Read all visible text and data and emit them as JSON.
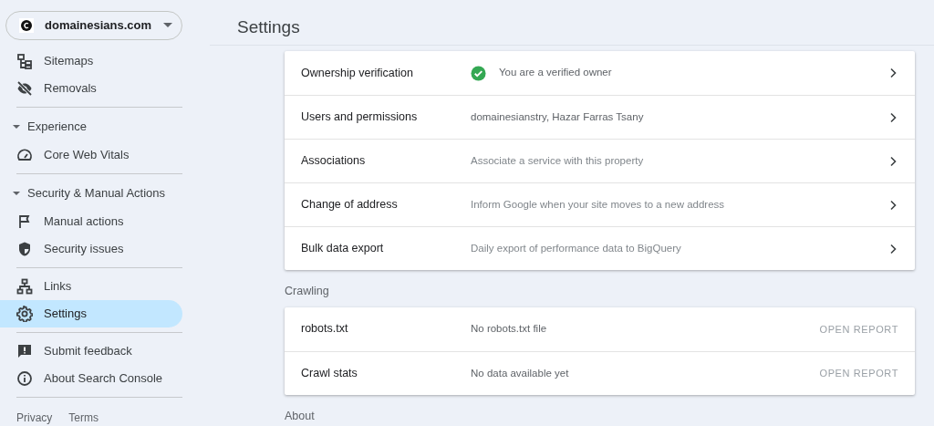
{
  "sidebar": {
    "property": "domainesians.com",
    "groups": [
      {
        "items": [
          {
            "label": "Sitemaps",
            "selected": false
          },
          {
            "label": "Removals",
            "selected": false
          }
        ]
      },
      {
        "heading": "Experience",
        "expanded": true,
        "items": [
          {
            "label": "Core Web Vitals",
            "selected": false
          }
        ]
      },
      {
        "heading": "Security & Manual Actions",
        "expanded": true,
        "items": [
          {
            "label": "Manual actions",
            "selected": false
          },
          {
            "label": "Security issues",
            "selected": false
          }
        ]
      },
      {
        "items": [
          {
            "label": "Links",
            "selected": false
          },
          {
            "label": "Settings",
            "selected": true
          }
        ]
      },
      {
        "items": [
          {
            "label": "Submit feedback",
            "selected": false
          },
          {
            "label": "About Search Console",
            "selected": false
          }
        ]
      }
    ],
    "footer_links": [
      "Privacy",
      "Terms"
    ]
  },
  "page_title": "Settings",
  "sections": [
    {
      "rows": [
        {
          "label": "Ownership verification",
          "value": "You are a verified owner",
          "kind": "value",
          "verified": true
        },
        {
          "label": "Users and permissions",
          "value": "domainesianstry, Hazar Farras Tsany",
          "kind": "value",
          "verified": false
        },
        {
          "label": "Associations",
          "value": "Associate a service with this property",
          "kind": "hint",
          "verified": false
        },
        {
          "label": "Change of address",
          "value": "Inform Google when your site moves to a new address",
          "kind": "hint",
          "verified": false
        },
        {
          "label": "Bulk data export",
          "value": "Daily export of performance data to BigQuery",
          "kind": "hint",
          "verified": false
        }
      ]
    },
    {
      "heading": "Crawling",
      "rows": [
        {
          "label": "robots.txt",
          "value": "No robots.txt file",
          "kind": "value",
          "verified": false,
          "action": "OPEN REPORT"
        },
        {
          "label": "Crawl stats",
          "value": "No data available yet",
          "kind": "value",
          "verified": false,
          "action": "OPEN REPORT"
        }
      ]
    },
    {
      "heading": "About"
    }
  ]
}
